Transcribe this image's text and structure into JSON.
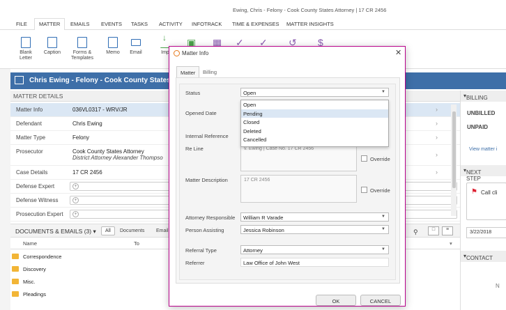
{
  "window_title": "Ewing, Chris - Felony - Cook County States Attorney | 17 CR 2456",
  "menu": [
    "FILE",
    "MATTER",
    "EMAILS",
    "EVENTS",
    "TASKS",
    "ACTIVITY",
    "INFOTRACK",
    "TIME & EXPENSES",
    "MATTER INSIGHTS"
  ],
  "menu_active": "MATTER",
  "ribbon": {
    "blank_letter": "Blank Letter",
    "caption": "Caption",
    "forms_templates": "Forms & Templates",
    "memo": "Memo",
    "email": "Email",
    "import": "Imp"
  },
  "matter_header": "Chris Ewing - Felony - Cook County States Atto",
  "matter_details": {
    "section_title": "MATTER DETAILS",
    "rows": [
      {
        "label": "Matter Info",
        "value": "036VL0317 - WRV/JR"
      },
      {
        "label": "Defendant",
        "value": "Chris Ewing"
      },
      {
        "label": "Matter Type",
        "value": "Felony"
      },
      {
        "label": "Prosecutor",
        "value": "Cook County States Attorney",
        "sub": "District Attorney Alexander Thompso"
      },
      {
        "label": "Case Details",
        "value": "17 CR 2456"
      },
      {
        "label": "Defense Expert",
        "value": ""
      },
      {
        "label": "Defense Witness",
        "value": ""
      },
      {
        "label": "Prosecution Expert",
        "value": ""
      }
    ]
  },
  "documents": {
    "title": "DOCUMENTS & EMAILS (3)",
    "filter_all": "All",
    "filter_documents": "Documents",
    "filter_emails": "Email",
    "col_name": "Name",
    "col_to": "To",
    "folders": [
      "Correspondence",
      "Discovery",
      "Misc.",
      "Pleadings"
    ]
  },
  "right_panel": {
    "billing_header": "BILLING",
    "unbilled": "UNBILLED",
    "unpaid": "UNPAID",
    "view_matter": "View matter i",
    "next_step_header": "NEXT STEP",
    "call_text": "Call cli",
    "date": "3/22/2018",
    "contact_header": "CONTACT",
    "contact_letter": "N"
  },
  "modal": {
    "title": "Matter Info",
    "tabs": [
      "Matter",
      "Billing"
    ],
    "status_label": "Status",
    "status_value": "Open",
    "status_options": [
      "Open",
      "Pending",
      "Closed",
      "Deleted",
      "Cancelled"
    ],
    "opened_date_label": "Opened Date",
    "internal_ref_label": "Internal Reference",
    "re_line_label": "Re Line",
    "re_line_value": "v. Ewing | Case No. 17 CR 2456",
    "override_label": "Override",
    "description_label": "Matter Description",
    "description_value": "17 CR 2456",
    "attorney_label": "Attorney Responsible",
    "attorney_value": "William R Varade",
    "assisting_label": "Person Assisting",
    "assisting_value": "Jessica Robinson",
    "referral_type_label": "Referral Type",
    "referral_type_value": "Attorney",
    "referrer_label": "Referrer",
    "referrer_value": "Law Office of John West",
    "ok": "OK",
    "cancel": "CANCEL"
  }
}
